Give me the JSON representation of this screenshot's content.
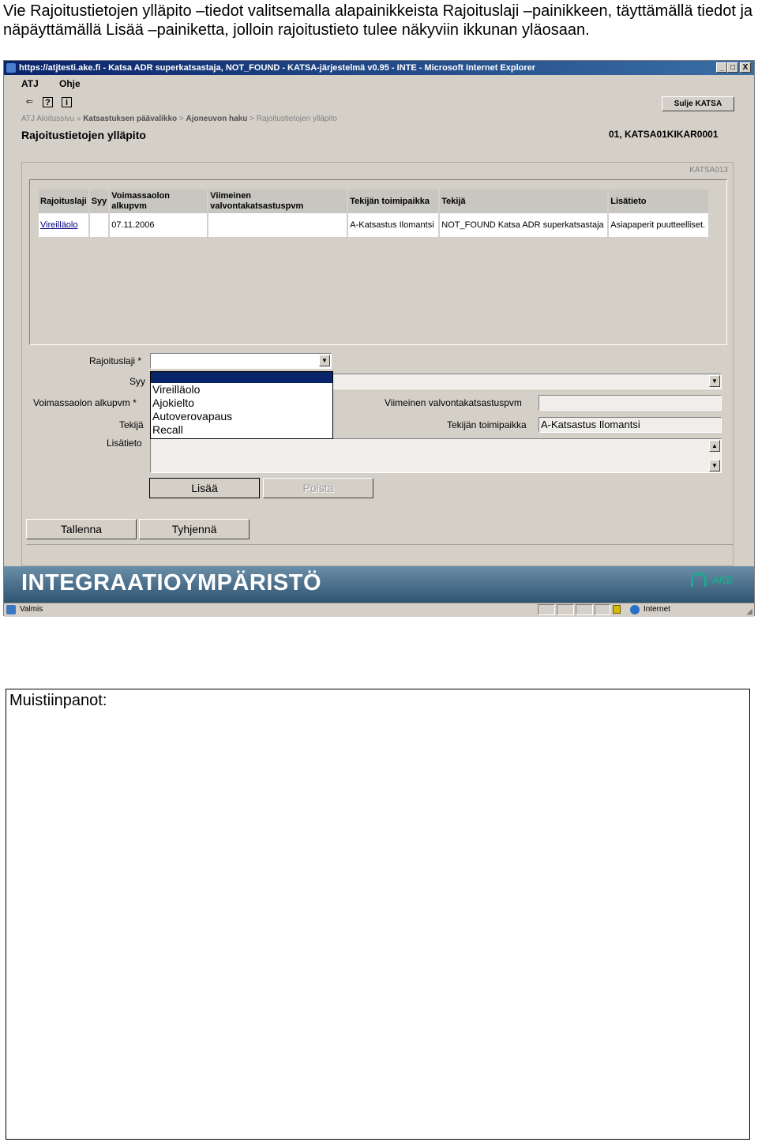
{
  "instructions": "Vie Rajoitustietojen ylläpito –tiedot valitsemalla alapainikkeista Rajoituslaji –painikkeen, täyttämällä tiedot ja näpäyttämällä Lisää –painiketta, jolloin rajoitustieto tulee näkyviin ikkunan yläosaan.",
  "window": {
    "title": "https://atjtesti.ake.fi - Katsa ADR superkatsastaja, NOT_FOUND - KATSA-järjestelmä v0.95 - INTE - Microsoft Internet Explorer",
    "controls": [
      "_",
      "□",
      "X"
    ]
  },
  "menu": {
    "items": [
      "ATJ",
      "Ohje"
    ]
  },
  "toolbar": {
    "icons": [
      "back-arrow-icon",
      "help-icon",
      "info-icon"
    ],
    "close_label": "Sulje KATSA"
  },
  "breadcrumb": {
    "items": [
      "ATJ Aloitussivu",
      "Katsastuksen päävalikko",
      "Ajoneuvon haku",
      "Rajoitustietojen ylläpito"
    ],
    "separators": [
      "»",
      ">",
      ">"
    ]
  },
  "page": {
    "title": "Rajoitustietojen ylläpito",
    "user": "01, KATSA01KIKAR0001",
    "code": "KATSA013"
  },
  "table": {
    "headers": [
      "Rajoituslaji",
      "Syy",
      "Voimassaolon alkupvm",
      "Viimeinen valvontakatsastuspvm",
      "Tekijän toimipaikka",
      "Tekijä",
      "Lisätieto"
    ],
    "rows": [
      {
        "rajoituslaji": "Vireilläolo",
        "syy": "",
        "alkupvm": "07.11.2006",
        "viimeinen": "",
        "toimipaikka": "A-Katsastus Ilomantsi",
        "tekija": "NOT_FOUND Katsa ADR superkatsastaja",
        "lisatieto": "Asiapaperit puutteelliset."
      }
    ]
  },
  "form": {
    "rajoituslaji_label": "Rajoituslaji *",
    "syy_label": "Syy",
    "alkupvm_label": "Voimassaolon alkupvm *",
    "tekija_label": "Tekijä",
    "lisatieto_label": "Lisätieto",
    "viimeinen_label": "Viimeinen valvontakatsastuspvm",
    "toimipaikka_label": "Tekijän toimipaikka",
    "toimipaikka_value": "A-Katsastus Ilomantsi",
    "rajoituslaji_value": "",
    "viimeinen_value": "",
    "lisatieto_value": "",
    "dropdown_options": [
      "Vireilläolo",
      "Ajokielto",
      "Autoverovapaus",
      "Recall"
    ]
  },
  "buttons": {
    "lisaa": "Lisää",
    "poista": "Poista",
    "tallenna": "Tallenna",
    "tyhjenna": "Tyhjennä"
  },
  "footer": {
    "env": "INTEGRAATIOYMPÄRISTÖ",
    "logo_text": "AKE"
  },
  "status": {
    "text": "Valmis",
    "zone": "Internet"
  },
  "notes": {
    "label": "Muistiinpanot:"
  }
}
